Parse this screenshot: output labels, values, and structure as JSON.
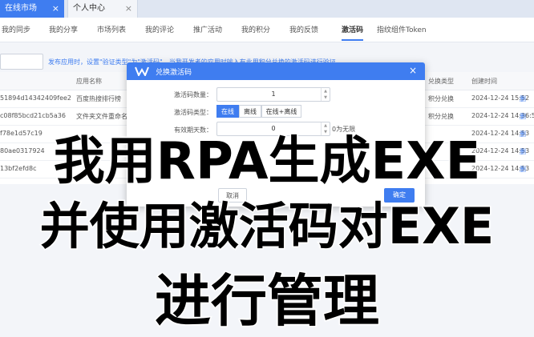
{
  "tabs": [
    {
      "label": "在线市场",
      "close": "×"
    },
    {
      "label": "个人中心",
      "close": "×"
    }
  ],
  "nav": {
    "items": [
      "我的同步",
      "我的分享",
      "市场列表",
      "我的评论",
      "推广活动",
      "我的积分",
      "我的反馈",
      "激活码",
      "指纹组件Token"
    ],
    "active_index": 7
  },
  "toolbar": {
    "notice": "发布应用时，设置\"验证类型\"为\"激活码\"，当我开发者的应用时输入有此用积分兑换的激活码进行验证"
  },
  "table": {
    "headers": {
      "app": "应用名称",
      "type": "兑换类型",
      "time": "创建时间"
    },
    "rows": [
      {
        "code": "51894d14342409fee2",
        "app": "百度热搜排行榜",
        "type": "积分兑换",
        "time": "2024-12-24 15:52",
        "del": "删"
      },
      {
        "code": "c08f85bcd21cb5a36",
        "app": "文件夹文件重命名",
        "type": "积分兑换",
        "time": "2024-12-24 14:36:53",
        "del": "删"
      },
      {
        "code": "f78e1d57c19",
        "app": "",
        "type": "",
        "time": "2024-12-24 14:53",
        "del": "删"
      },
      {
        "code": "80ae0317924",
        "app": "",
        "type": "",
        "time": "2024-12-24 14:53",
        "del": "删"
      },
      {
        "code": "13bf2efd8c",
        "app": "",
        "type": "",
        "time": "2024-12-24 14:53",
        "del": "删"
      }
    ]
  },
  "dialog": {
    "title": "兑换激活码",
    "close": "×",
    "fields": {
      "quantity_label": "激活码数量：",
      "quantity_value": "1",
      "type_label": "激活码类型：",
      "type_options": [
        "在线",
        "离线",
        "在线+离线"
      ],
      "type_selected_index": 0,
      "days_label": "有效期天数：",
      "days_value": "0",
      "days_suffix": "0为无限"
    },
    "cancel_label": "取消",
    "ok_label": "确定"
  },
  "banner": {
    "line1": "我用RPA生成EXE",
    "line2": "并使用激活码对EXE",
    "line3": "进行管理"
  },
  "colors": {
    "accent": "#3f7df0",
    "banner_text": "#000000",
    "banner_outline": "#ffffff"
  }
}
